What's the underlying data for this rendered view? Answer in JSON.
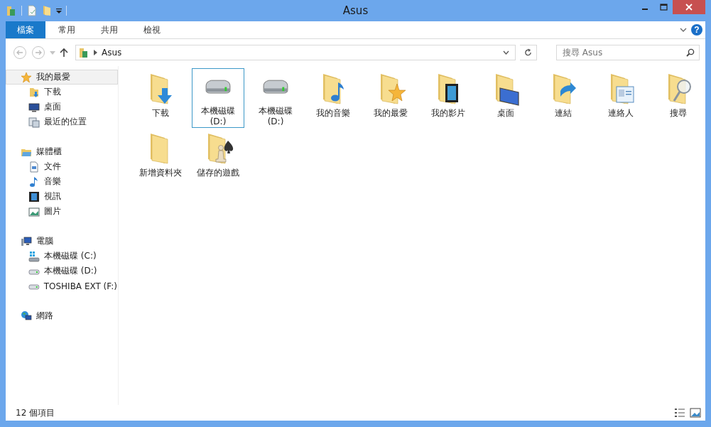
{
  "window": {
    "title": "Asus"
  },
  "ribbon": {
    "tabs": [
      {
        "label": "檔案",
        "selected": true
      },
      {
        "label": "常用",
        "selected": false
      },
      {
        "label": "共用",
        "selected": false
      },
      {
        "label": "檢視",
        "selected": false
      }
    ],
    "help": "?"
  },
  "address_bar": {
    "path": "Asus"
  },
  "search": {
    "placeholder": "搜尋 Asus"
  },
  "nav_pane": [
    {
      "label": "我的最愛",
      "kind": "favorites",
      "selected": true,
      "children": [
        {
          "label": "下載",
          "kind": "downloads",
          "selected": false
        },
        {
          "label": "桌面",
          "kind": "desktop",
          "selected": false
        },
        {
          "label": "最近的位置",
          "kind": "recent",
          "selected": false
        }
      ]
    },
    {
      "label": "媒體櫃",
      "kind": "library",
      "selected": false,
      "children": [
        {
          "label": "文件",
          "kind": "documents",
          "selected": false
        },
        {
          "label": "音樂",
          "kind": "music",
          "selected": false
        },
        {
          "label": "視訊",
          "kind": "video",
          "selected": false
        },
        {
          "label": "圖片",
          "kind": "pictures",
          "selected": false
        }
      ]
    },
    {
      "label": "電腦",
      "kind": "computer",
      "selected": false,
      "children": [
        {
          "label": "本機磁碟 (C:)",
          "kind": "system-drive",
          "selected": false
        },
        {
          "label": "本機磁碟 (D:)",
          "kind": "drive",
          "selected": false
        },
        {
          "label": "TOSHIBA EXT (F:)",
          "kind": "drive",
          "selected": false
        }
      ]
    },
    {
      "label": "網路",
      "kind": "network",
      "selected": false
    }
  ],
  "items": [
    {
      "label": "下載",
      "kind": "downloads",
      "selected": false
    },
    {
      "label": "本機磁碟 (D:)",
      "kind": "drive",
      "selected": true
    },
    {
      "label": "本機磁碟 (D:)",
      "kind": "drive",
      "selected": false
    },
    {
      "label": "我的音樂",
      "kind": "music",
      "selected": false
    },
    {
      "label": "我的最愛",
      "kind": "favorites",
      "selected": false
    },
    {
      "label": "我的影片",
      "kind": "video",
      "selected": false
    },
    {
      "label": "桌面",
      "kind": "desktop",
      "selected": false
    },
    {
      "label": "連結",
      "kind": "links",
      "selected": false
    },
    {
      "label": "連絡人",
      "kind": "contacts",
      "selected": false
    },
    {
      "label": "搜尋",
      "kind": "searches",
      "selected": false
    },
    {
      "label": "新增資料夾",
      "kind": "folder",
      "selected": false
    },
    {
      "label": "儲存的遊戲",
      "kind": "games",
      "selected": false
    }
  ],
  "status_bar": {
    "count": "12 個項目"
  }
}
